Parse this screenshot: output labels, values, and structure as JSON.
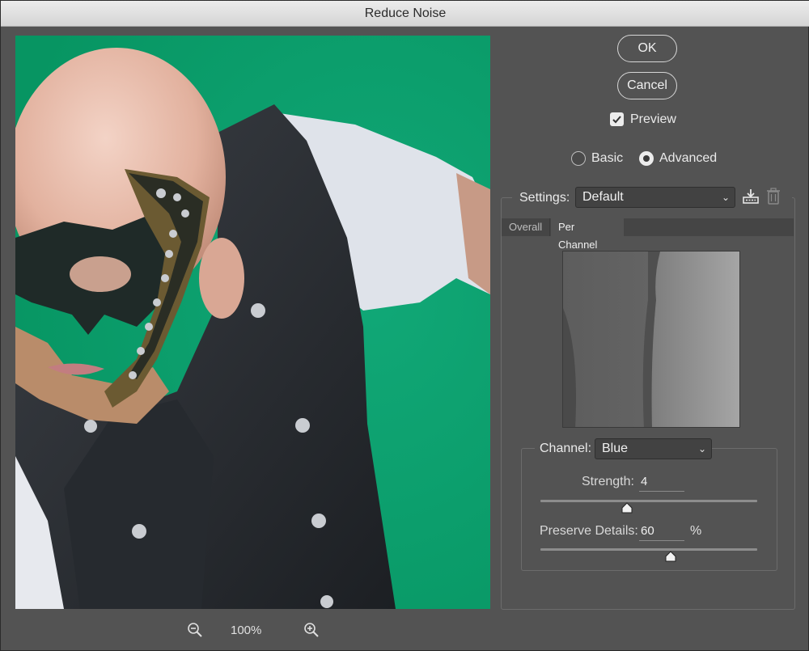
{
  "window": {
    "title": "Reduce Noise"
  },
  "buttons": {
    "ok": "OK",
    "cancel": "Cancel"
  },
  "preview_option": {
    "label": "Preview",
    "checked": true
  },
  "mode": {
    "basic": "Basic",
    "advanced": "Advanced",
    "selected": "Advanced"
  },
  "settings": {
    "label": "Settings:",
    "value": "Default"
  },
  "tabs": [
    {
      "label": "Overall"
    },
    {
      "label": "Per Channel",
      "active": true
    }
  ],
  "channel": {
    "label": "Channel:",
    "value": "Blue",
    "strength_label": "Strength:",
    "strength_value": "4",
    "strength_slider_fraction": 0.4,
    "preserve_label": "Preserve Details:",
    "preserve_value": "60",
    "preserve_unit": "%",
    "preserve_slider_fraction": 0.6
  },
  "zoom": {
    "level": "100%"
  },
  "colors": {
    "backdrop": "#0fa874",
    "panel": "#535353"
  }
}
